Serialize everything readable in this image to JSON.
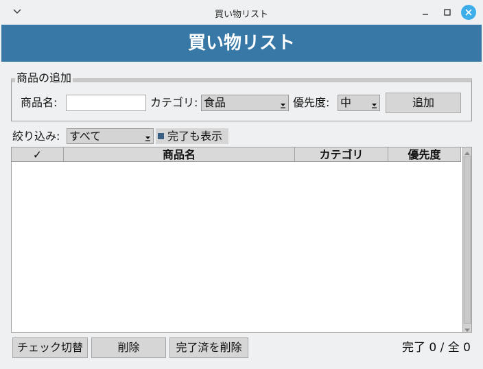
{
  "window": {
    "title": "買い物リスト"
  },
  "header": {
    "title": "買い物リスト",
    "color": "#3778a7"
  },
  "add_section": {
    "legend": "商品の追加",
    "name_label": "商品名:",
    "name_value": "",
    "category_label": "カテゴリ:",
    "category_value": "食品",
    "priority_label": "優先度:",
    "priority_value": "中",
    "add_button": "追加"
  },
  "filter": {
    "label": "絞り込み:",
    "value": "すべて",
    "show_done_label": "完了も表示",
    "show_done_checked": true
  },
  "table": {
    "columns": [
      "✓",
      "商品名",
      "カテゴリ",
      "優先度"
    ],
    "rows": []
  },
  "actions": {
    "toggle_check": "チェック切替",
    "delete": "削除",
    "delete_done": "完了済を削除"
  },
  "status": {
    "text": "完了 0 / 全 0"
  },
  "icons": {
    "menu": "chevron-down-icon",
    "minimize": "minimize-icon",
    "maximize": "maximize-icon",
    "close": "close-icon"
  },
  "colors": {
    "accent": "#3daee9",
    "checkbox": "#3a5f84"
  }
}
